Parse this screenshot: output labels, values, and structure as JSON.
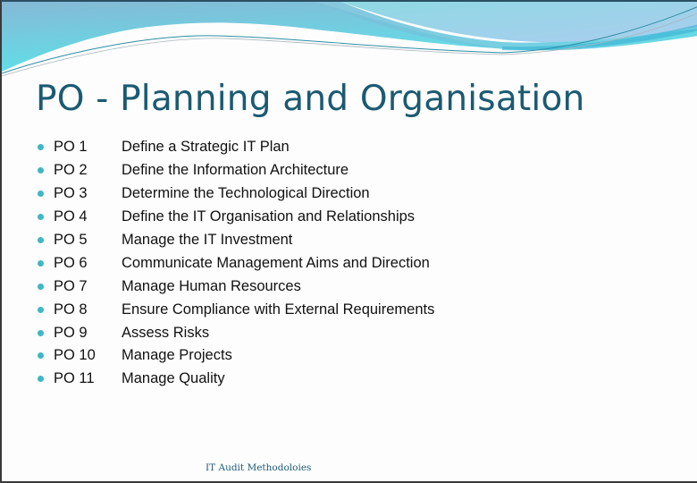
{
  "slide": {
    "title": "PO - Planning and Organisation",
    "items": [
      {
        "code": "PO 1",
        "description": "Define a Strategic IT Plan"
      },
      {
        "code": "PO 2",
        "description": "Define the Information Architecture"
      },
      {
        "code": "PO 3",
        "description": "Determine the Technological Direction"
      },
      {
        "code": "PO 4",
        "description": "Define the IT Organisation and Relationships"
      },
      {
        "code": "PO 5",
        "description": "Manage the IT Investment"
      },
      {
        "code": "PO 6",
        "description": "Communicate Management Aims and Direction"
      },
      {
        "code": "PO 7",
        "description": "Manage Human Resources"
      },
      {
        "code": "PO 8",
        "description": "Ensure Compliance with External Requirements"
      },
      {
        "code": "PO 9",
        "description": "Assess Risks"
      },
      {
        "code": "PO 10",
        "description": "Manage Projects"
      },
      {
        "code": "PO 11",
        "description": "Manage Quality"
      }
    ],
    "footer": "IT Audit Methodoloies",
    "bullet_icon": "dot-bullet-icon",
    "colors": {
      "title": "#1b5a72",
      "bullet": "#3fb7c4",
      "wave_light": "#9fd8e6",
      "wave_cyan": "#5fd3e0",
      "wave_blue": "#7fb8d8"
    }
  }
}
